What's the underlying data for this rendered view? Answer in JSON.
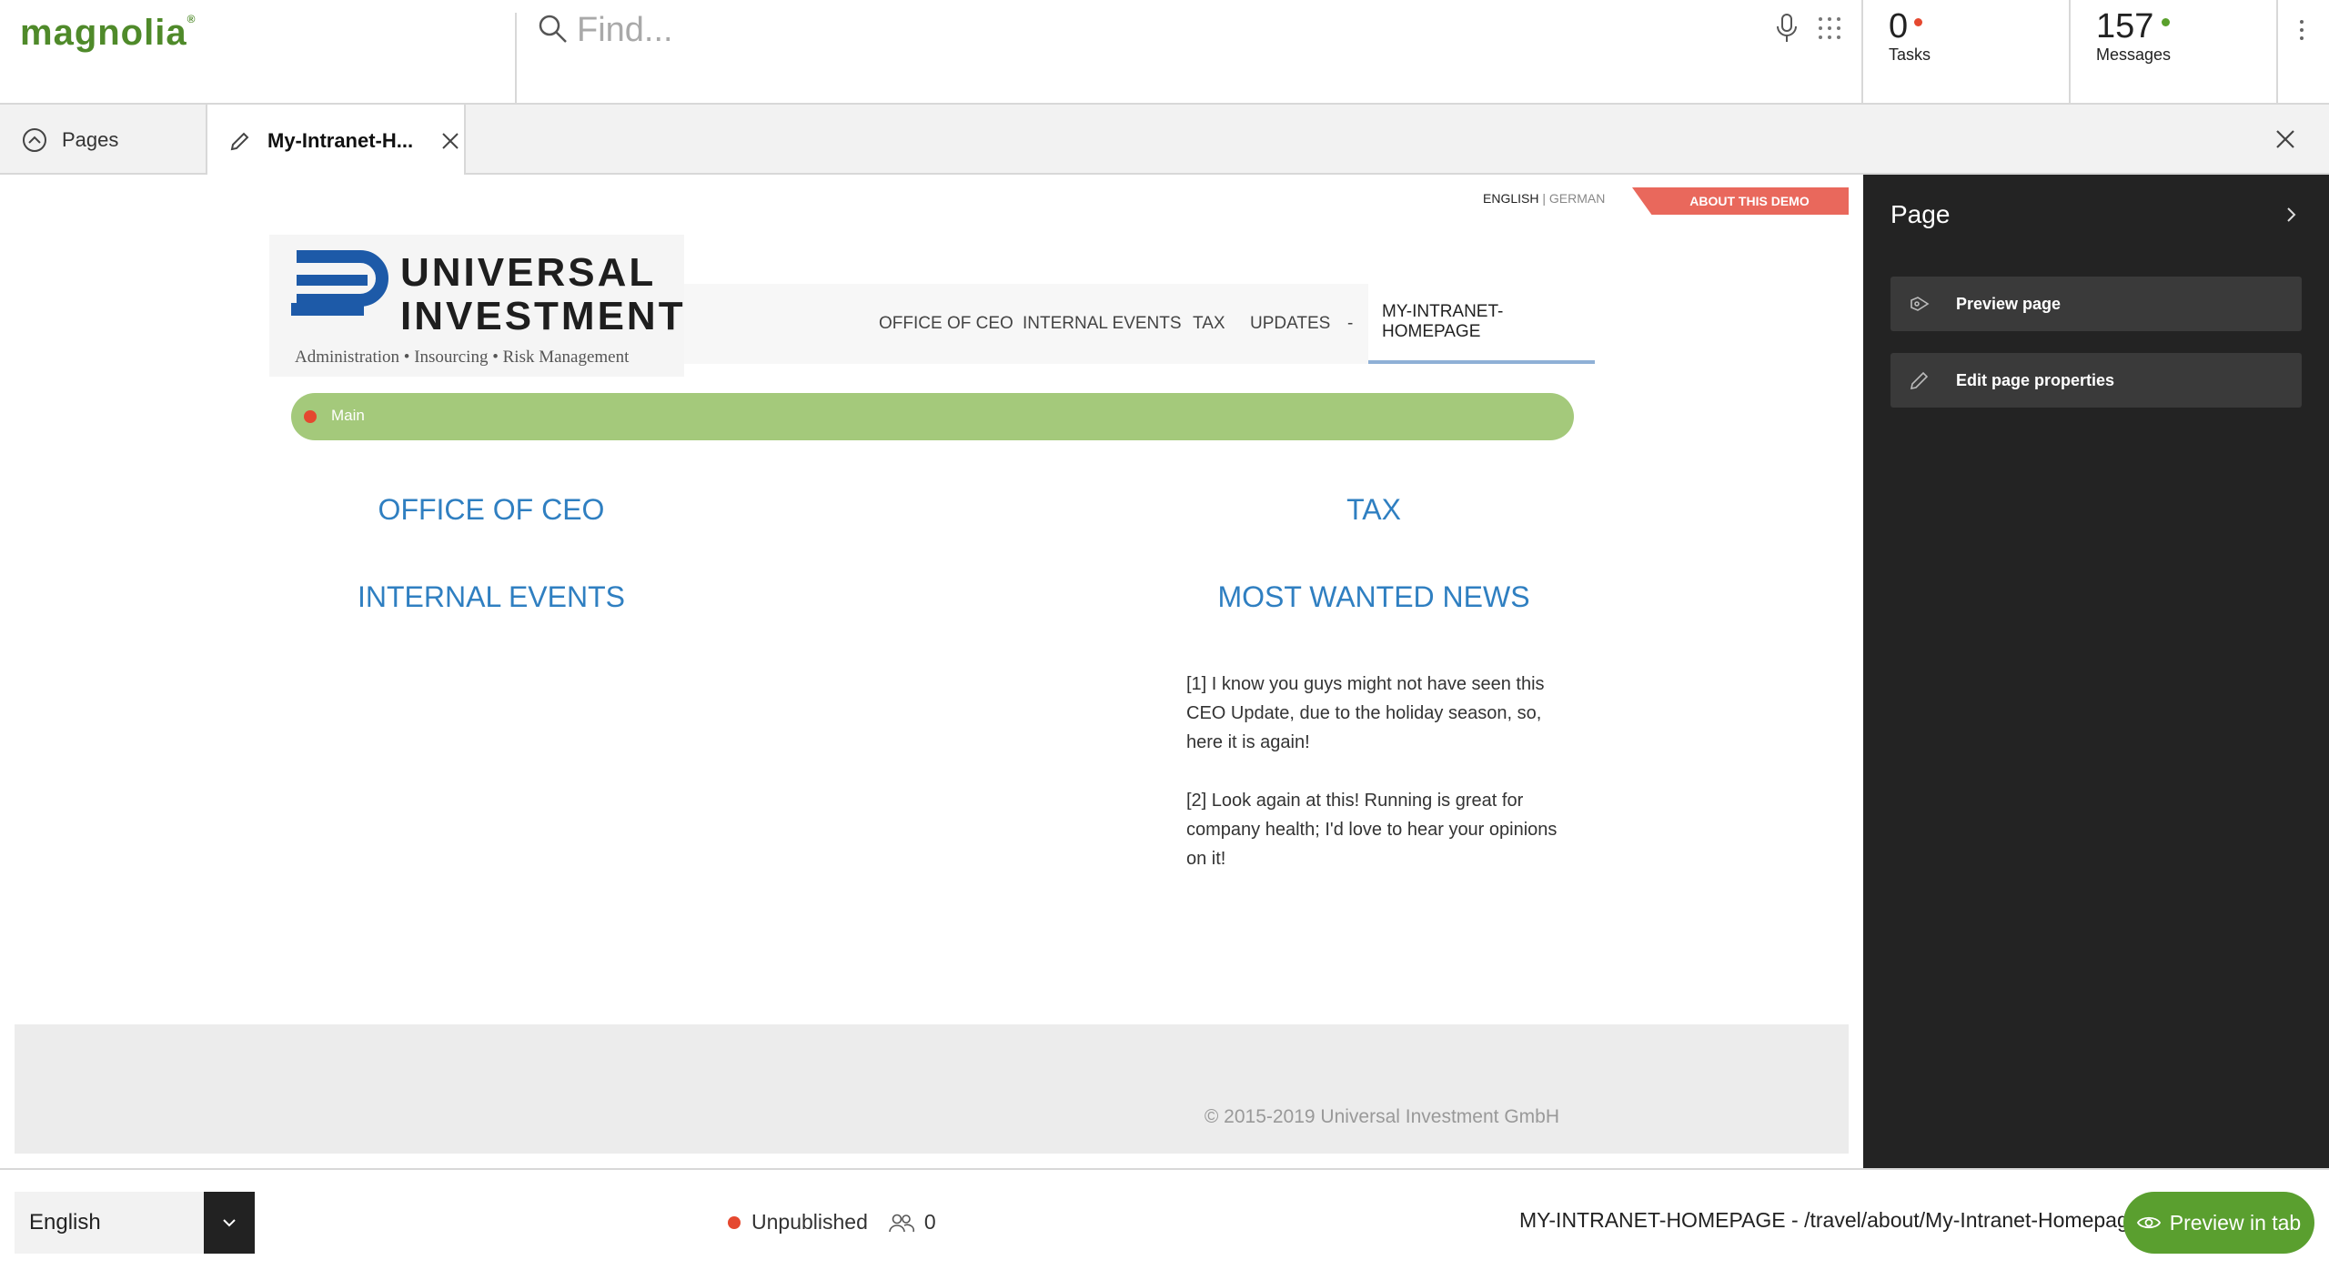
{
  "app": {
    "logo_text": "magnolia",
    "logo_mark": "®"
  },
  "search": {
    "placeholder": "Find..."
  },
  "counters": {
    "tasks_count": "0",
    "tasks_label": "Tasks",
    "tasks_dot_color": "#e5482f",
    "messages_count": "157",
    "messages_label": "Messages",
    "messages_dot_color": "#5aa02c"
  },
  "tabs": {
    "pages_label": "Pages",
    "edit_label": "My-Intranet-H..."
  },
  "site": {
    "lang_english": "ENGLISH",
    "lang_sep": "|",
    "lang_german": "GERMAN",
    "about_demo": "ABOUT THIS DEMO",
    "brand_line1": "UNIVERSAL",
    "brand_line2": "INVESTMENT",
    "brand_tagline": "Administration • Insourcing • Risk Management",
    "nav": [
      {
        "label": "OFFICE OF CEO"
      },
      {
        "label": "INTERNAL EVENTS"
      },
      {
        "label": "TAX"
      },
      {
        "label": "UPDATES"
      },
      {
        "label": "-"
      },
      {
        "label": "MY-INTRANET-HOMEPAGE"
      }
    ],
    "main_area_label": "Main",
    "sections": {
      "office_of_ceo": "OFFICE OF CEO",
      "tax": "TAX",
      "internal_events": "INTERNAL EVENTS",
      "most_wanted_news": "MOST WANTED NEWS"
    },
    "news": [
      "[1] I know you guys might not have seen this CEO Update, due to the holiday season, so, here it is again!",
      "[2] Look again at this! Running is great for company health; I'd love to hear your opinions on it!"
    ],
    "copyright": "© 2015-2019 Universal Investment GmbH"
  },
  "panel": {
    "title": "Page",
    "actions": [
      {
        "label": "Preview page",
        "icon": "preview-tag-icon"
      },
      {
        "label": "Edit page properties",
        "icon": "pencil-icon"
      }
    ]
  },
  "bottom": {
    "language": "English",
    "status": "Unpublished",
    "users_count": "0",
    "path": "MY-INTRANET-HOMEPAGE - /travel/about/My-Intranet-Homepage",
    "preview_tab": "Preview in tab"
  },
  "colors": {
    "brand_green": "#5a9f2f",
    "area_green": "#a4c97b",
    "heading_blue": "#2f7fc1",
    "demo_red": "#e9685c",
    "panel_bg": "#232323"
  }
}
